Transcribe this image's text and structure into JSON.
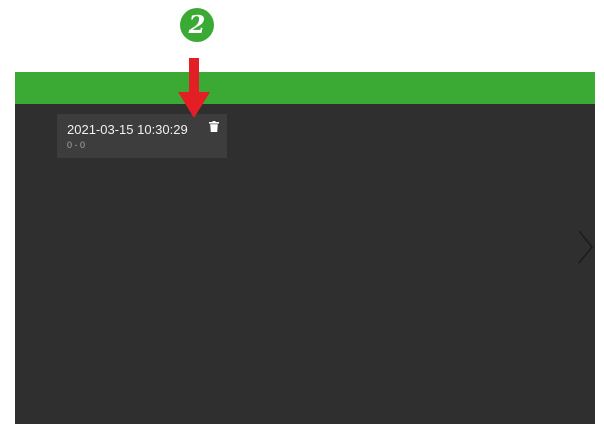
{
  "annotation": {
    "step_number": "2",
    "badge_color": "#3aaa35",
    "arrow_color": "#e31e24"
  },
  "app": {
    "header_color": "#3aaa35",
    "background_color": "#2f2f2f"
  },
  "session_card": {
    "title": "2021-03-15 10:30:29",
    "subtitle": "0 - 0",
    "delete_icon": "trash-icon"
  },
  "navigation": {
    "next_icon": "chevron-right-icon"
  }
}
